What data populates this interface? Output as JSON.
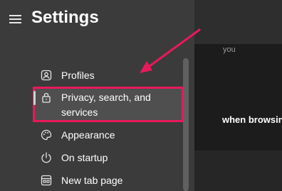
{
  "app": {
    "title": "Settings"
  },
  "sidebar": {
    "items": [
      {
        "label": "Profiles",
        "icon": "profile-icon"
      },
      {
        "label": "Privacy, search, and services",
        "icon": "lock-icon",
        "selected": true
      },
      {
        "label": "Appearance",
        "icon": "palette-icon"
      },
      {
        "label": "On startup",
        "icon": "power-icon"
      },
      {
        "label": "New tab page",
        "icon": "new-tab-icon"
      }
    ]
  },
  "main": {
    "faint_text": "you",
    "bold_text": "when browsing"
  },
  "colors": {
    "highlight": "#e8195a",
    "sidebar_bg": "#3b3b3b",
    "main_bg": "#1c1c1c"
  }
}
